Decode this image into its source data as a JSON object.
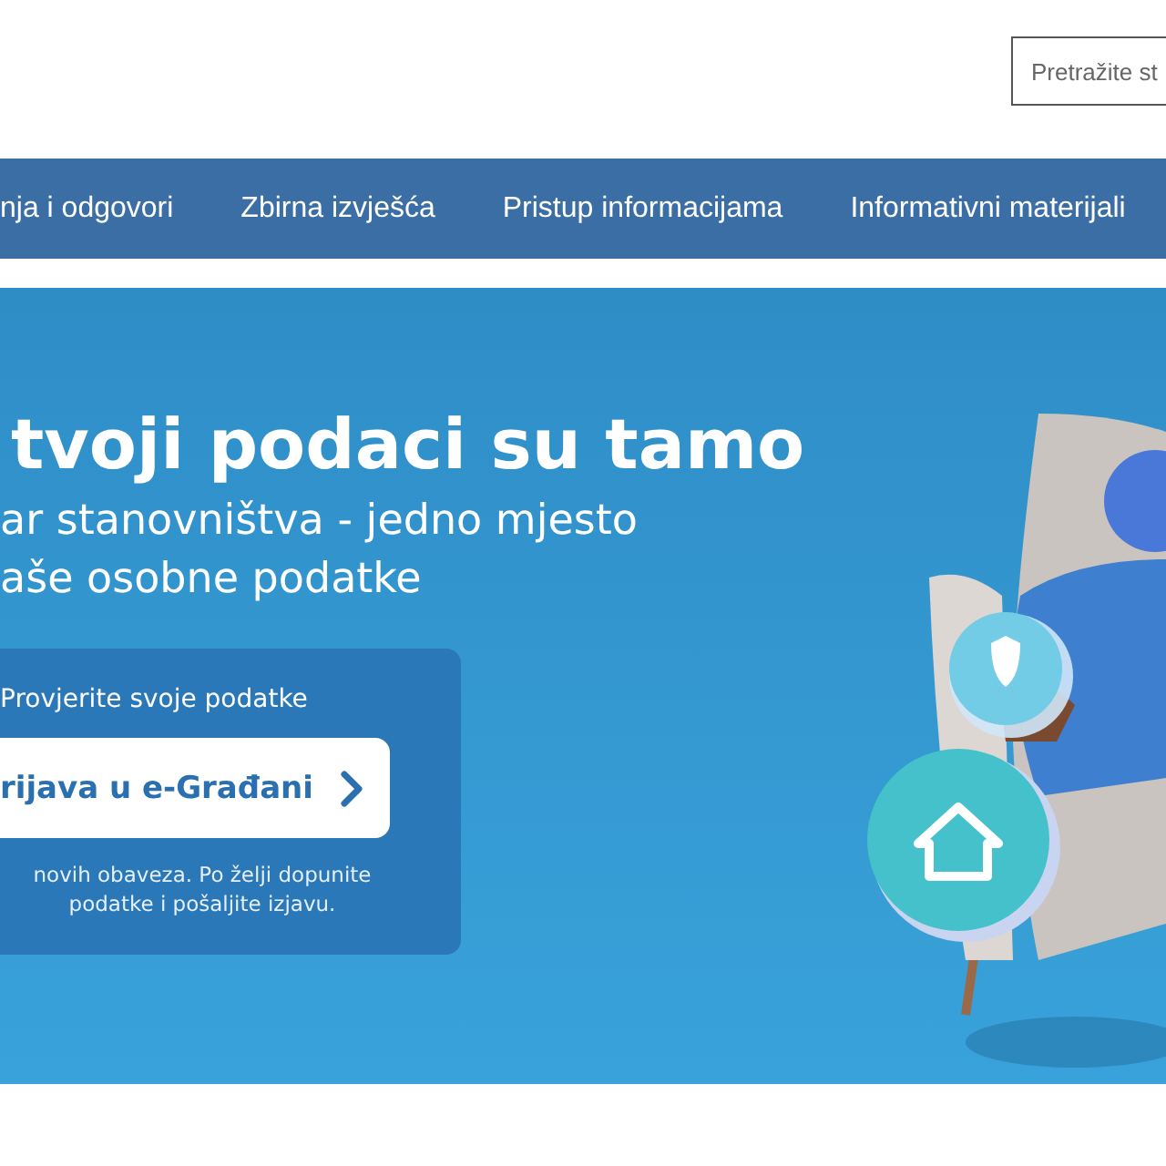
{
  "search": {
    "placeholder": "Pretražite st"
  },
  "nav": [
    {
      "label": "nja i odgovori"
    },
    {
      "label": "Zbirna izvješća"
    },
    {
      "label": "Pristup informacijama"
    },
    {
      "label": "Informativni materijali"
    }
  ],
  "hero": {
    "title": "tvoji podaci su tamo",
    "subtitle_lines": [
      "ar stanovništva - jedno mjesto",
      "aše osobne podatke"
    ],
    "card": {
      "title": "Provjerite svoje podatke",
      "button": "rijava u e-Građani",
      "note_lines": [
        "novih obaveza. Po želji dopunite",
        "podatke i pošaljite izjavu."
      ]
    }
  }
}
